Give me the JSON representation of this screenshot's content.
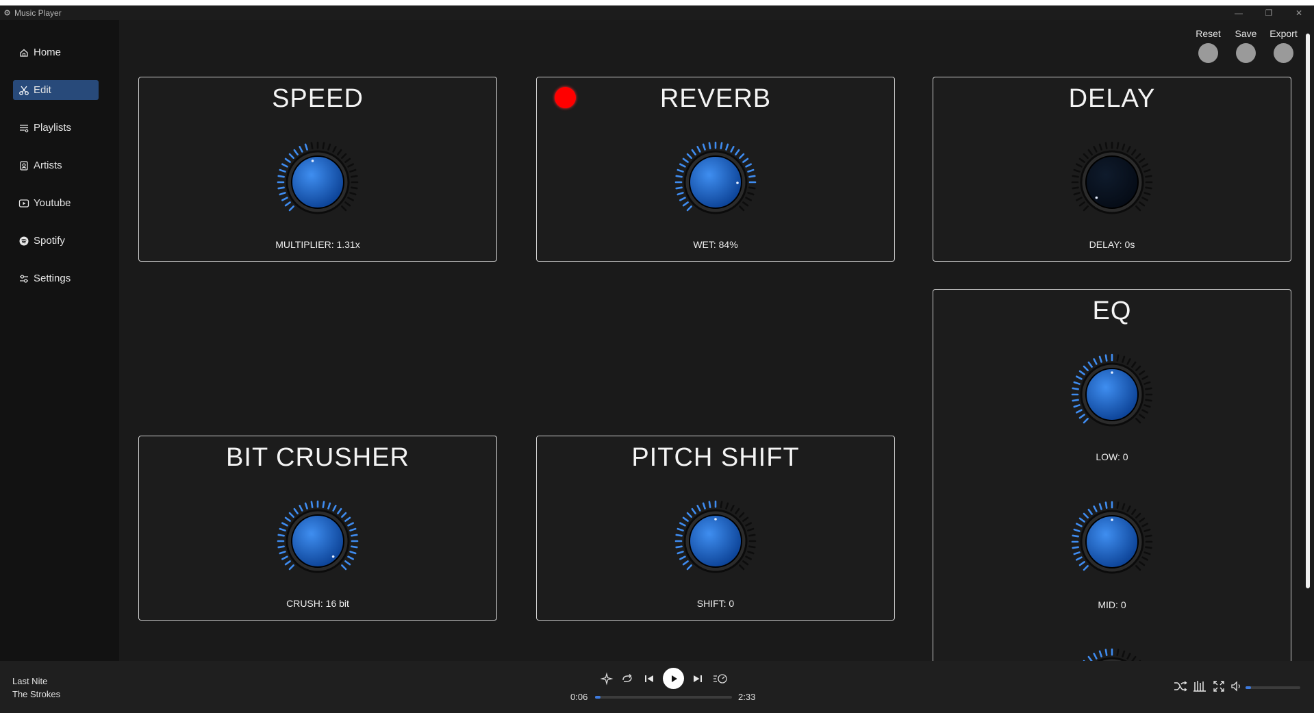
{
  "window": {
    "title": "Music Player",
    "minimize": "—",
    "maximize": "❐",
    "close": "✕"
  },
  "sidebar": {
    "items": [
      {
        "label": "Home",
        "icon": "home-icon"
      },
      {
        "label": "Edit",
        "icon": "scissors-icon",
        "active": true
      },
      {
        "label": "Playlists",
        "icon": "playlist-icon"
      },
      {
        "label": "Artists",
        "icon": "artist-icon"
      },
      {
        "label": "Youtube",
        "icon": "youtube-icon"
      },
      {
        "label": "Spotify",
        "icon": "spotify-icon"
      },
      {
        "label": "Settings",
        "icon": "settings-icon"
      }
    ]
  },
  "actions": {
    "reset": "Reset",
    "save": "Save",
    "export": "Export"
  },
  "effects": {
    "speed": {
      "title": "SPEED",
      "value_text": "MULTIPLIER: 1.31x",
      "level": 0.45,
      "enabled": true
    },
    "reverb": {
      "title": "REVERB",
      "value_text": "WET: 84%",
      "level": 0.84,
      "enabled": true,
      "led": "active"
    },
    "delay": {
      "title": "DELAY",
      "value_text": "DELAY: 0s",
      "level": 0.0,
      "enabled": false
    },
    "bitcrusher": {
      "title": "BIT CRUSHER",
      "value_text": "CRUSH: 16 bit",
      "level": 1.0,
      "enabled": true
    },
    "pitch": {
      "title": "PITCH SHIFT",
      "value_text": "SHIFT: 0",
      "level": 0.5,
      "enabled": true
    },
    "eq": {
      "title": "EQ",
      "low": {
        "value_text": "LOW: 0",
        "level": 0.5
      },
      "mid": {
        "value_text": "MID: 0",
        "level": 0.5
      }
    }
  },
  "colors": {
    "accent": "#3d7be0",
    "tick_on": "#3f8cf0",
    "tick_off": "#0d0d0d",
    "led": "#ff0000",
    "active_nav": "#284a7a"
  },
  "player": {
    "track": "Last Nite",
    "artist": "The Strokes",
    "elapsed": "0:06",
    "duration": "2:33",
    "progress": 0.04,
    "volume": 0.1,
    "icons": [
      "sparkle-icon",
      "loop-icon",
      "previous-icon",
      "play-icon",
      "next-icon",
      "queue-speed-icon",
      "shuffle-icon",
      "equalizer-icon",
      "fullscreen-icon",
      "volume-icon"
    ]
  }
}
